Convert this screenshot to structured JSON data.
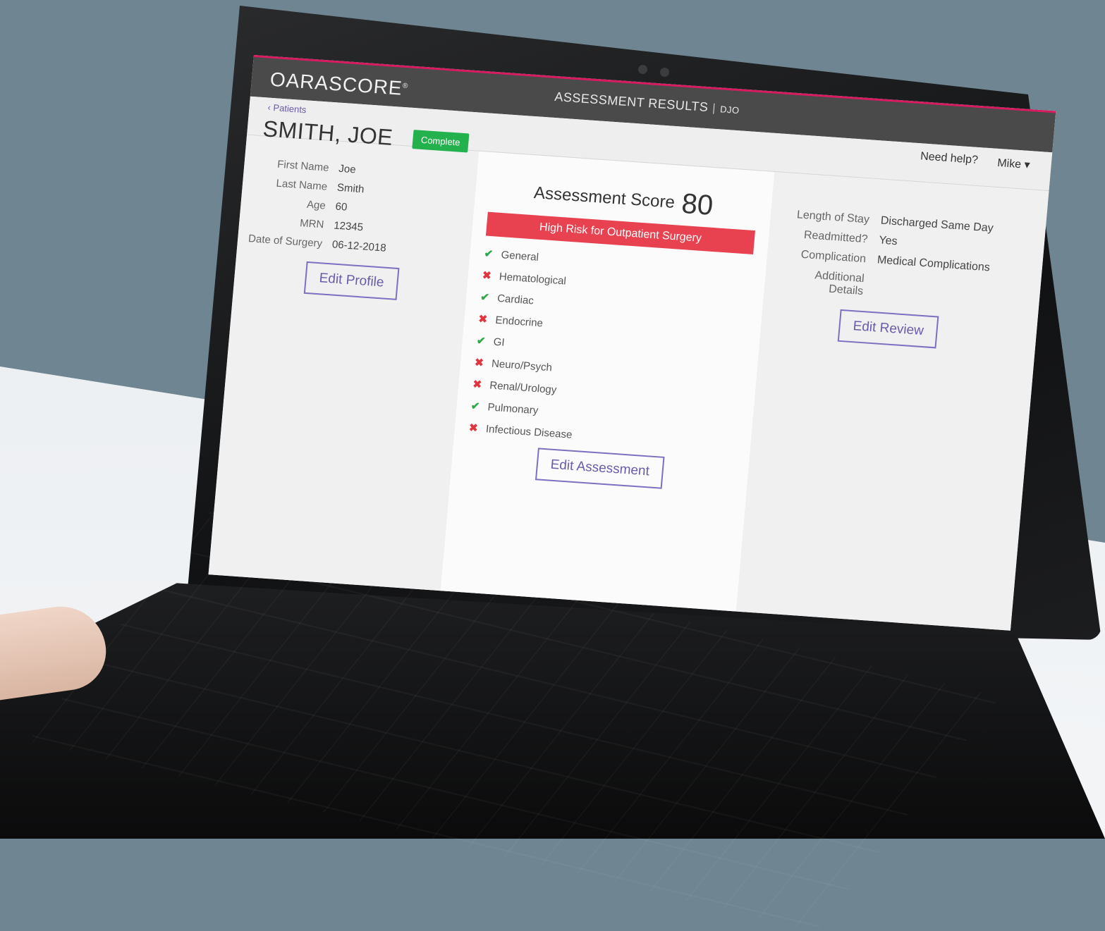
{
  "app": {
    "logo": "OARASCORE",
    "page_heading": "ASSESSMENT RESULTS",
    "page_tag": "DJO",
    "help_link": "Need help?",
    "user_name": "Mike",
    "back_link": "Patients"
  },
  "patient": {
    "name": "SMITH, JOE",
    "status": "Complete",
    "fields": [
      {
        "label": "First Name",
        "value": "Joe"
      },
      {
        "label": "Last Name",
        "value": "Smith"
      },
      {
        "label": "Age",
        "value": "60"
      },
      {
        "label": "MRN",
        "value": "12345"
      },
      {
        "label": "Date of Surgery",
        "value": "06-12-2018"
      }
    ],
    "edit_button": "Edit Profile"
  },
  "assessment": {
    "title": "Assessment Score",
    "score": "80",
    "risk": "High Risk for Outpatient Surgery",
    "items": [
      {
        "label": "General",
        "ok": true
      },
      {
        "label": "Hematological",
        "ok": false
      },
      {
        "label": "Cardiac",
        "ok": true
      },
      {
        "label": "Endocrine",
        "ok": false
      },
      {
        "label": "GI",
        "ok": true
      },
      {
        "label": "Neuro/Psych",
        "ok": false
      },
      {
        "label": "Renal/Urology",
        "ok": false
      },
      {
        "label": "Pulmonary",
        "ok": true
      },
      {
        "label": "Infectious Disease",
        "ok": false
      }
    ],
    "edit_button": "Edit Assessment",
    "colors": {
      "risk": "#e8414f",
      "ok": "#2ea84a",
      "bad": "#e0343f"
    }
  },
  "review": {
    "fields": [
      {
        "label": "Length of Stay",
        "value": "Discharged Same Day"
      },
      {
        "label": "Readmitted?",
        "value": "Yes"
      },
      {
        "label": "Complication",
        "value": "Medical Complications"
      },
      {
        "label": "Additional Details",
        "value": ""
      }
    ],
    "edit_button": "Edit Review"
  },
  "icons": {
    "back": "chevron-left-icon",
    "user_menu": "caret-down-icon",
    "check": "check-icon",
    "cross": "cross-icon"
  }
}
